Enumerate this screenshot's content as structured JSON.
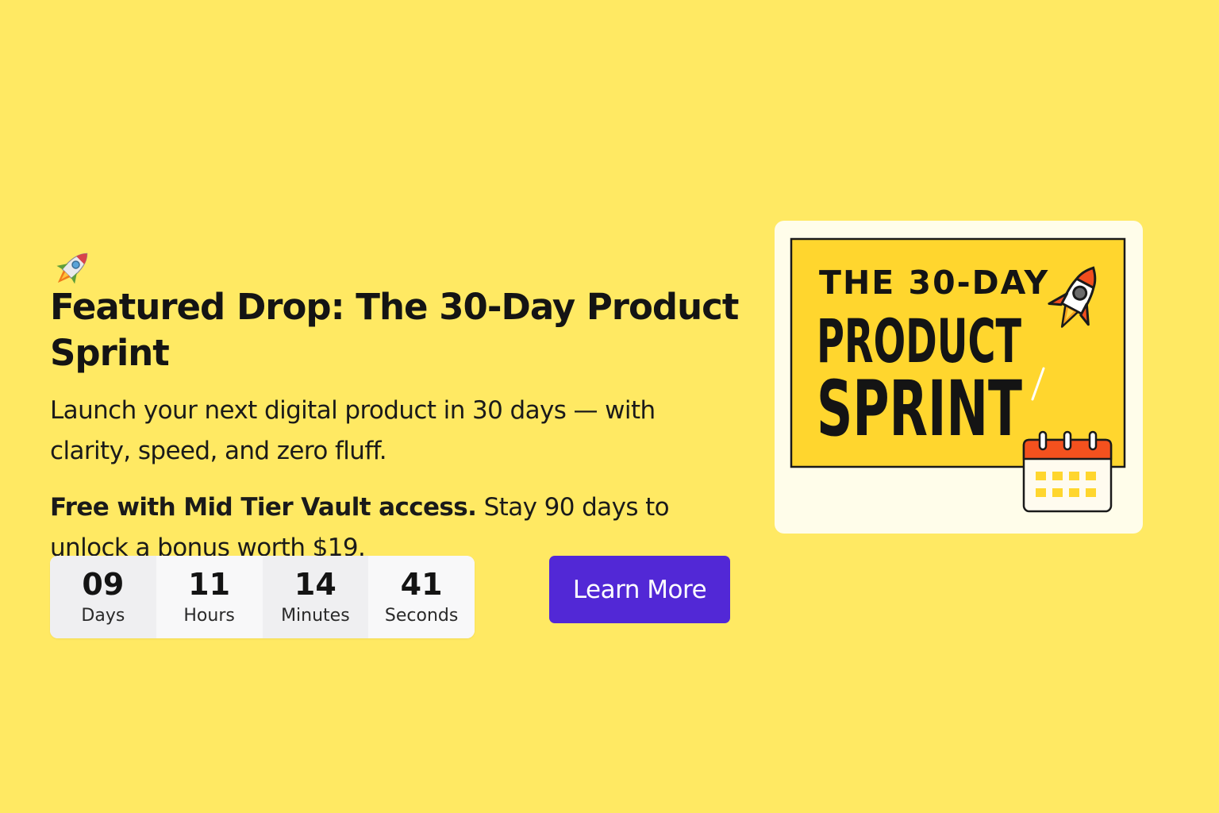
{
  "hero": {
    "title": "Featured Drop: The 30-Day Product Sprint",
    "title_icon": "rocket-icon",
    "description": "Launch your next digital product in 30 days — with clarity, speed, and zero fluff.",
    "offer_bold": "Free with Mid Tier Vault access.",
    "offer_rest": " Stay 90 days to unlock a bonus worth $19."
  },
  "countdown": {
    "days": {
      "value": "09",
      "label": "Days"
    },
    "hours": {
      "value": "11",
      "label": "Hours"
    },
    "minutes": {
      "value": "14",
      "label": "Minutes"
    },
    "seconds": {
      "value": "41",
      "label": "Seconds"
    }
  },
  "cta": {
    "label": "Learn More",
    "color": "#5228D6"
  },
  "product_image": {
    "line1": "THE 30-DAY",
    "line2": "PRODUCT",
    "line3": "SPRINT",
    "icons": [
      "rocket-icon",
      "calendar-icon"
    ]
  },
  "colors": {
    "background": "#FFE963",
    "poster": "#FFD62E",
    "card": "#FFFDEA",
    "calendar_header": "#F4511E"
  }
}
